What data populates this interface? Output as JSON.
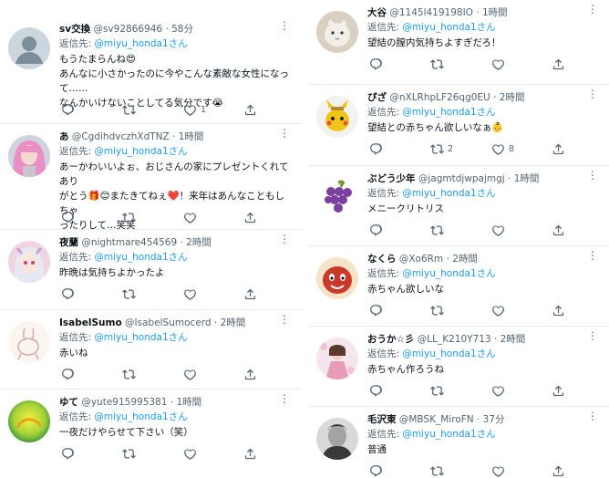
{
  "reply_prefix": "返信先:",
  "mention": "@miyu_honda1さん",
  "left_tweets": [
    {
      "name": "sv交換",
      "handle": "@sv92866946",
      "time": "· 58分",
      "lines": [
        "もうたまらんね😍",
        "あんなに小さかったのに今やこんな素敵な女性になって……",
        "なんかいけないことしてる気分です😭"
      ],
      "likes": "1",
      "retweets": "",
      "avatar": "default-gray"
    },
    {
      "name": "あ",
      "handle": "@CgdihdvczhXdTNZ",
      "time": "· 1時間",
      "lines": [
        "あーかわいいよぉ、おじさんの家にプレゼントくれてあり",
        "がとう🎁😊またきてねぇ❤️！来年はあんなこともしちゃ",
        "ったりして…笑笑"
      ],
      "likes": "",
      "retweets": "",
      "avatar": "pink-hair"
    },
    {
      "name": "夜蘭",
      "handle": "@nightmare454569",
      "time": "· 2時間",
      "lines": [
        "昨晩は気持ちよかったよ"
      ],
      "likes": "",
      "retweets": "",
      "avatar": "anime-girl"
    },
    {
      "name": "IsabelSumo",
      "handle": "@IsabelSumocerd",
      "time": "· 2時間",
      "lines": [
        "赤いね"
      ],
      "likes": "",
      "retweets": "",
      "avatar": "line-rabbit"
    },
    {
      "name": "ゆて",
      "handle": "@yute915995381",
      "time": "· 1時間",
      "lines": [
        "一夜だけやらせて下さい（笑）"
      ],
      "likes": "",
      "retweets": "",
      "avatar": "yellow-green"
    }
  ],
  "right_tweets": [
    {
      "name": "大谷",
      "handle": "@1145l419198IO",
      "time": "· 1時間",
      "lines": [
        "望結の膣内気持ちよすぎだろ！"
      ],
      "likes": "",
      "retweets": "",
      "avatar": "white-cat"
    },
    {
      "name": "ぴざ",
      "handle": "@nXLRhpLF26qg0EU",
      "time": "· 2時間",
      "lines": [
        "望結との赤ちゃん欲しいなぁ👶"
      ],
      "likes": "8",
      "retweets": "2",
      "avatar": "pikachu"
    },
    {
      "name": "ぶどう少年",
      "handle": "@jagmtdjwpajmgj",
      "time": "· 1時間",
      "lines": [
        "メニークリトリス"
      ],
      "likes": "",
      "retweets": "",
      "avatar": "grapes"
    },
    {
      "name": "なくら",
      "handle": "@Xo6Rm",
      "time": "· 2時間",
      "lines": [
        "赤ちゃん欲しいな"
      ],
      "likes": "",
      "retweets": "",
      "avatar": "red-character"
    },
    {
      "name": "おうか☆彡",
      "handle": "@LL_K210Y713",
      "time": "· 2時間",
      "lines": [
        "赤ちゃん作ろうね"
      ],
      "likes": "",
      "retweets": "",
      "avatar": "pink-dress"
    },
    {
      "name": "毛沢東",
      "handle": "@MBSK_MiroFN",
      "time": "· 37分",
      "lines": [
        "普通"
      ],
      "likes": "",
      "retweets": "",
      "avatar": "bw-portrait"
    }
  ]
}
